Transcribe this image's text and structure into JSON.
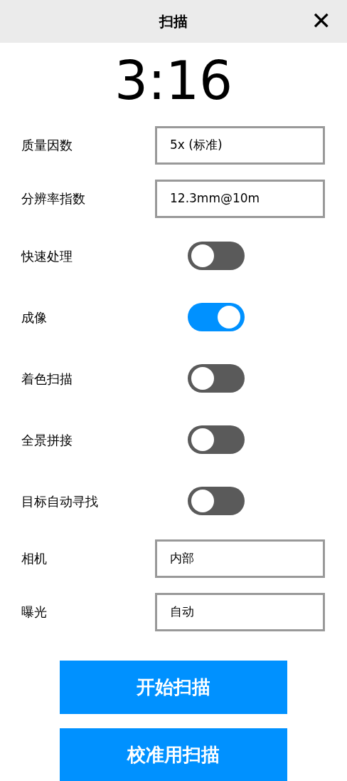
{
  "window": {
    "title": "扫描",
    "close": "✕"
  },
  "timer": "3:16",
  "rows": [
    {
      "kind": "field",
      "label": "质量因数",
      "value": "5x (标准)"
    },
    {
      "kind": "field",
      "label": "分辨率指数",
      "value": "12.3mm@10m"
    },
    {
      "kind": "toggle",
      "label": "快速处理",
      "on": false
    },
    {
      "kind": "toggle",
      "label": "成像",
      "on": true
    },
    {
      "kind": "toggle",
      "label": "着色扫描",
      "on": false
    },
    {
      "kind": "toggle",
      "label": "全景拼接",
      "on": false
    },
    {
      "kind": "toggle",
      "label": "目标自动寻找",
      "on": false
    },
    {
      "kind": "field",
      "label": "相机",
      "value": "内部"
    },
    {
      "kind": "field",
      "label": "曝光",
      "value": "自动"
    }
  ],
  "buttons": [
    "开始扫描",
    "校准用扫描"
  ]
}
